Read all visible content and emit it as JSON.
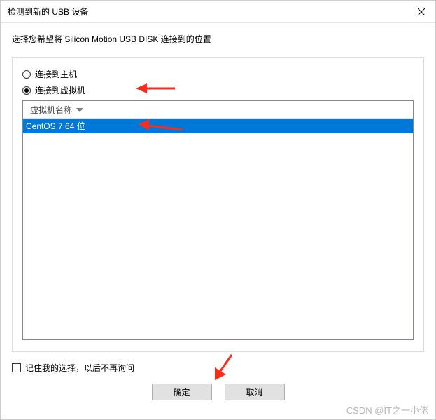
{
  "titlebar": {
    "title": "检测到新的 USB 设备"
  },
  "subtitle": "选择您希望将 Silicon Motion USB DISK 连接到的位置",
  "radios": {
    "host": {
      "label": "连接到主机",
      "selected": false
    },
    "vm": {
      "label": "连接到虚拟机",
      "selected": true
    }
  },
  "list": {
    "header": "虚拟机名称",
    "items": [
      {
        "label": "CentOS 7 64 位",
        "selected": true
      }
    ]
  },
  "remember": {
    "label": "记住我的选择，以后不再询问",
    "checked": false
  },
  "buttons": {
    "ok": "确定",
    "cancel": "取消"
  },
  "watermark": "CSDN @IT之一小佬",
  "colors": {
    "selection": "#0078d7",
    "arrow": "#fc2b1c"
  }
}
